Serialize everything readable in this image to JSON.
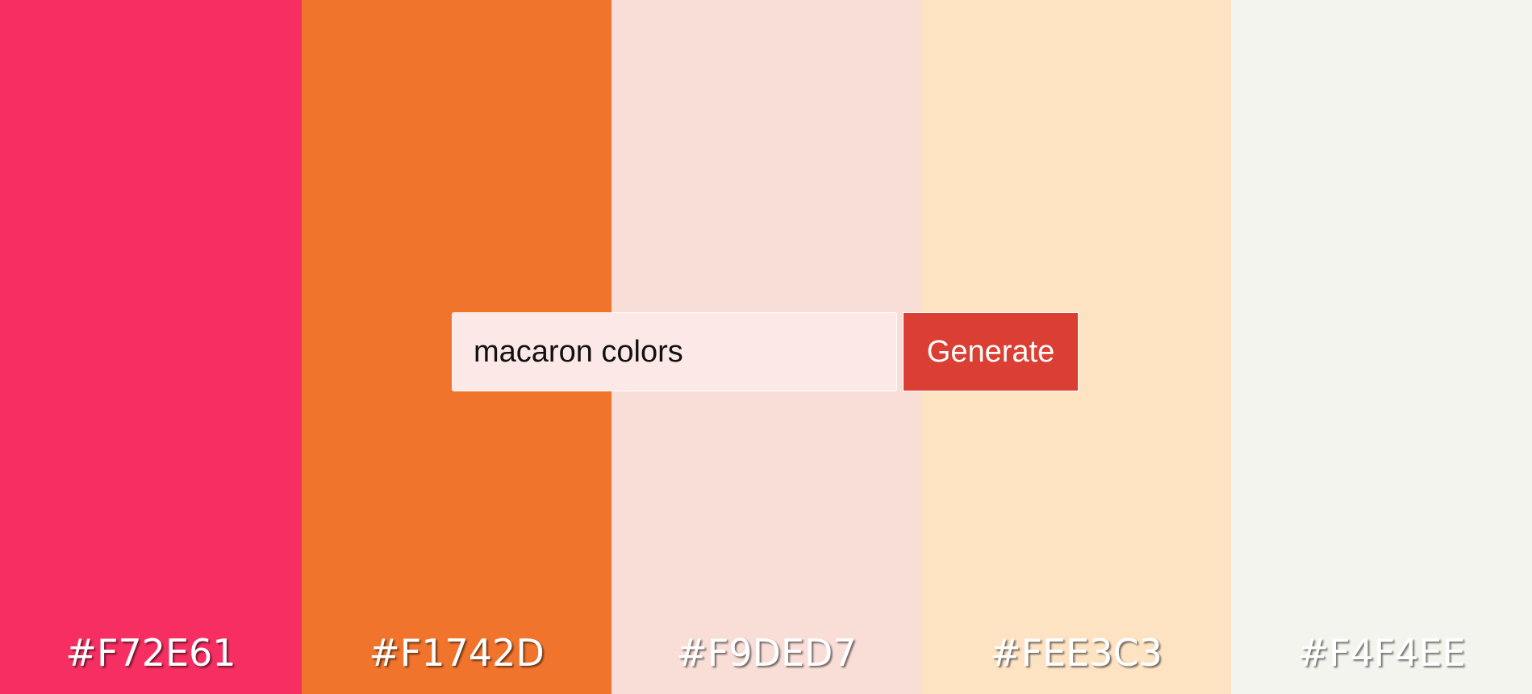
{
  "swatches": [
    {
      "hex": "#F72E61",
      "color": "#F72E61"
    },
    {
      "hex": "#F1742D",
      "color": "#F1742D"
    },
    {
      "hex": "#F9DED7",
      "color": "#F9DED7"
    },
    {
      "hex": "#FEE3C3",
      "color": "#FEE3C3"
    },
    {
      "hex": "#F4F4EE",
      "color": "#F4F4EE"
    }
  ],
  "search": {
    "value": "macaron colors",
    "input_background": "#fde8e8"
  },
  "generate": {
    "label": "Generate",
    "color": "#db3e32"
  }
}
